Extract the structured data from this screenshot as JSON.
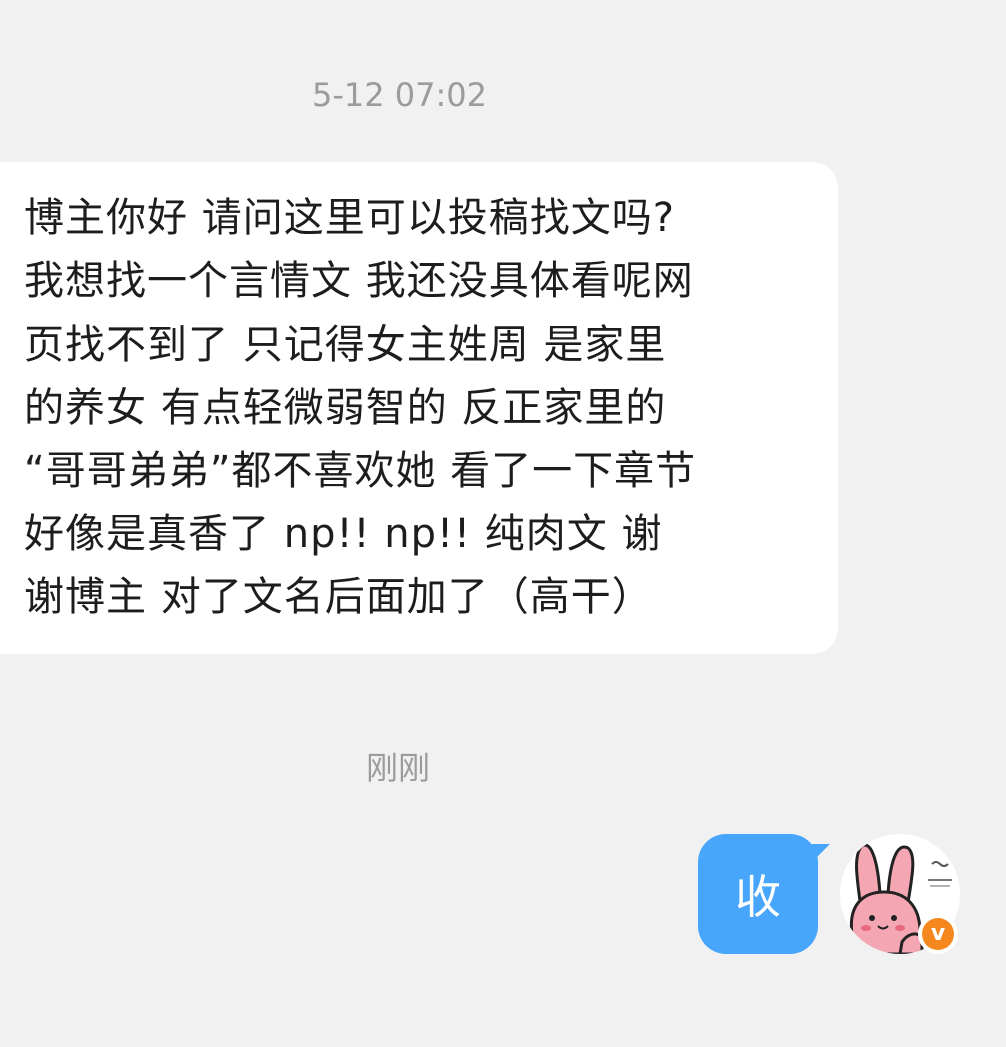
{
  "conversation": {
    "timestamp_1": "5-12 07:02",
    "incoming_message": {
      "lines": [
        "博主你好 请问这里可以投稿找文吗?",
        "我想找一个言情文 我还没具体看呢网",
        "页找不到了 只记得女主姓周 是家里",
        "的养女 有点轻微弱智的 反正家里的",
        "“哥哥弟弟”都不喜欢她 看了一下章节",
        "好像是真香了 np!! np!! 纯肉文 谢",
        "谢博主 对了文名后面加了（高干）"
      ]
    },
    "timestamp_2": "刚刚",
    "outgoing_message": {
      "text": "收"
    },
    "avatar": {
      "icon": "pink-bunny-avatar",
      "badge_icon": "verified-v-badge",
      "badge_text": "v"
    }
  },
  "colors": {
    "background": "#f1f1f1",
    "incoming_bubble": "#ffffff",
    "outgoing_bubble": "#47a6fb",
    "timestamp_text": "#9b9b9b",
    "badge": "#f5871f"
  }
}
